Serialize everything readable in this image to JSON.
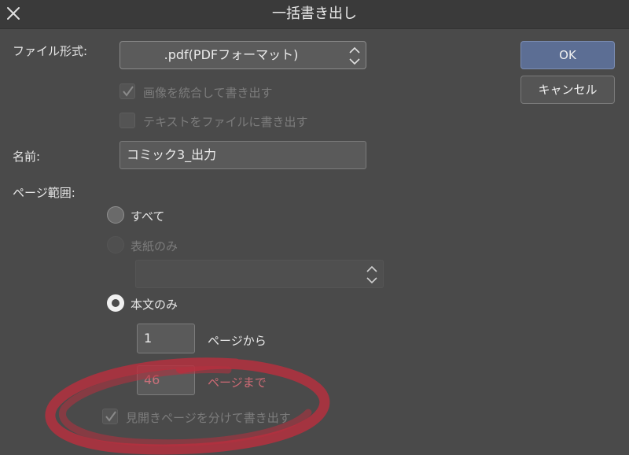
{
  "dialog": {
    "title": "一括書き出し"
  },
  "buttons": {
    "ok": "OK",
    "cancel": "キャンセル"
  },
  "file_format": {
    "label": "ファイル形式:",
    "selected": ".pdf(PDFフォーマット)"
  },
  "options": {
    "merge_images": "画像を統合して書き出す",
    "export_text": "テキストをファイルに書き出す"
  },
  "name": {
    "label": "名前:",
    "value": "コミック3_出力"
  },
  "page_range": {
    "label": "ページ範囲:",
    "all": "すべて",
    "cover_only": "表紙のみ",
    "body_only": "本文のみ",
    "from_value": "1",
    "from_suffix": "ページから",
    "to_value": "46",
    "to_suffix": "ページまで",
    "spread_split": "見開きページを分けて書き出す"
  },
  "annotation_color": "#b8303e"
}
